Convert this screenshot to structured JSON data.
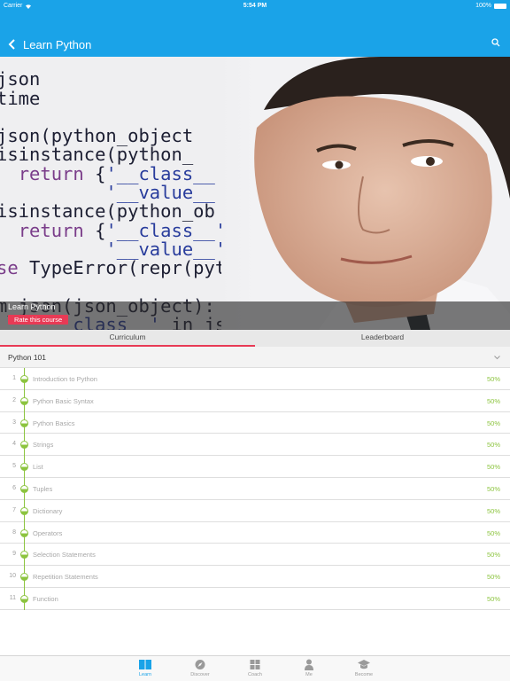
{
  "status_bar": {
    "carrier": "Carrier",
    "time": "5:54 PM",
    "battery": "100%"
  },
  "nav": {
    "title": "Learn Python",
    "back_icon": "chevron-left-icon",
    "search_icon": "search-icon"
  },
  "hero": {
    "course_title": "Learn Python",
    "rate_label": "Rate this course"
  },
  "tabs": [
    {
      "label": "Curriculum",
      "active": true
    },
    {
      "label": "Leaderboard",
      "active": false
    }
  ],
  "section": {
    "title": "Python 101"
  },
  "lessons": [
    {
      "num": "1",
      "title": "Introduction to Python",
      "progress": "50%"
    },
    {
      "num": "2",
      "title": "Python Basic Syntax",
      "progress": "50%"
    },
    {
      "num": "3",
      "title": "Python Basics",
      "progress": "50%"
    },
    {
      "num": "4",
      "title": "Strings",
      "progress": "50%"
    },
    {
      "num": "5",
      "title": "List",
      "progress": "50%"
    },
    {
      "num": "6",
      "title": "Tuples",
      "progress": "50%"
    },
    {
      "num": "7",
      "title": "Dictionary",
      "progress": "50%"
    },
    {
      "num": "8",
      "title": "Operators",
      "progress": "50%"
    },
    {
      "num": "9",
      "title": "Selection Statements",
      "progress": "50%"
    },
    {
      "num": "10",
      "title": "Repetition Statements",
      "progress": "50%"
    },
    {
      "num": "11",
      "title": "Function",
      "progress": "50%"
    }
  ],
  "tabbar": [
    {
      "label": "Learn",
      "icon": "book-icon",
      "active": true
    },
    {
      "label": "Discover",
      "icon": "compass-icon",
      "active": false
    },
    {
      "label": "Coach",
      "icon": "grid-icon",
      "active": false
    },
    {
      "label": "Me",
      "icon": "person-icon",
      "active": false
    },
    {
      "label": "Become",
      "icon": "graduation-cap-icon",
      "active": false
    }
  ],
  "colors": {
    "accent": "#1aa3e8",
    "progress": "#8cc43f",
    "highlight": "#e83a55"
  }
}
